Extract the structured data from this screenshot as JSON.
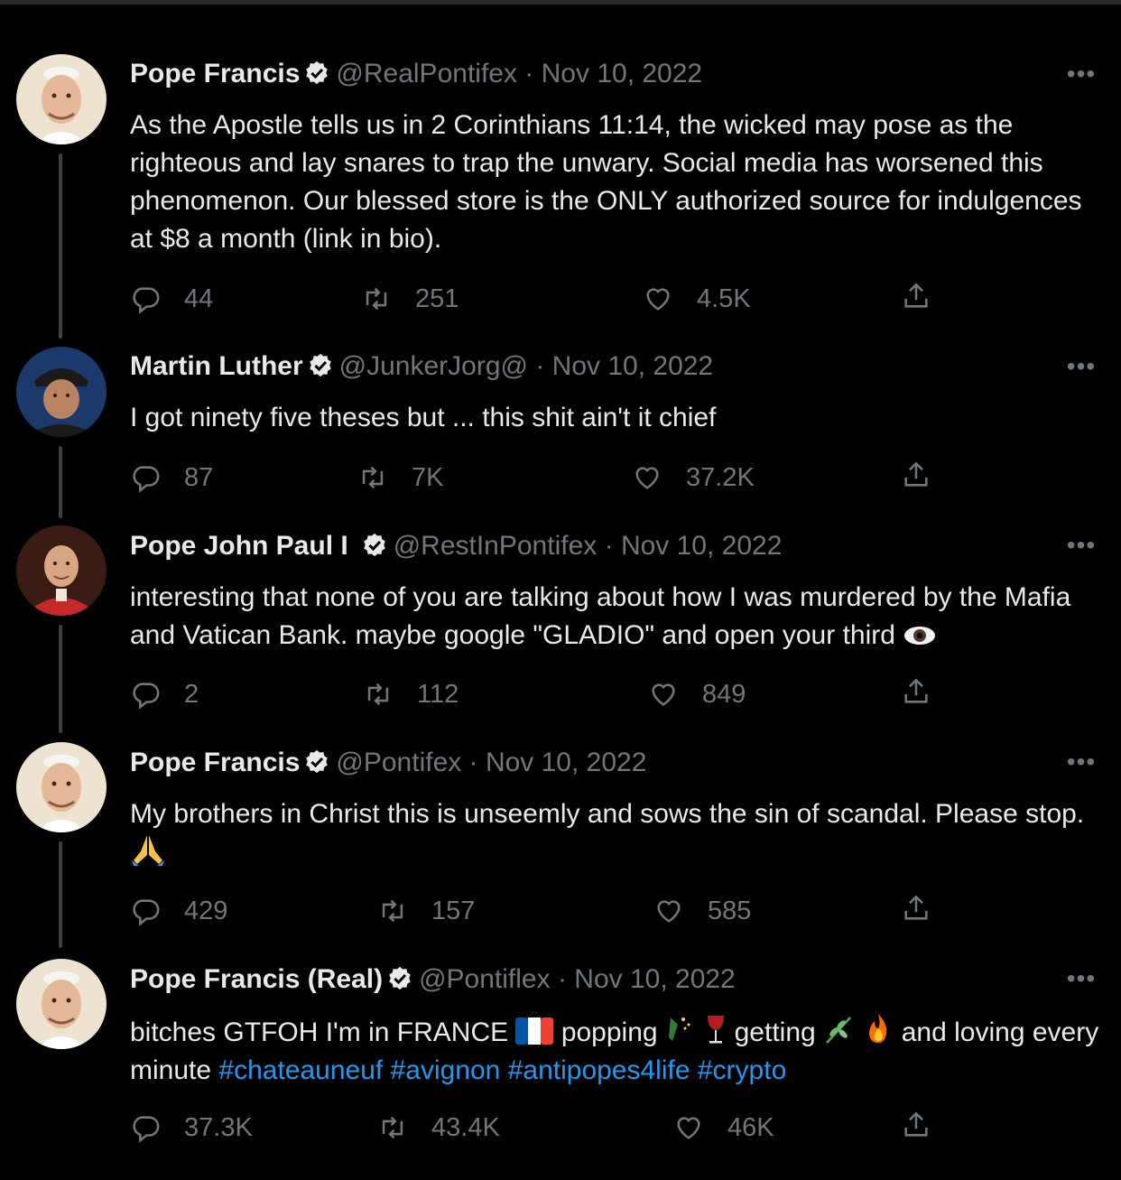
{
  "tweets": [
    {
      "name": "Pope Francis",
      "handle": "@RealPontifex",
      "dot": " · ",
      "date": "Nov 10, 2022",
      "text": "As the Apostle tells us in 2 Corinthians 11:14, the wicked may pose as the righteous and lay snares to trap the unwary. Social media has worsened this phenomenon. Our blessed store is the ONLY authorized source for indulgences at $8 a month (link in bio).",
      "replies": "44",
      "retweets": "251",
      "likes": "4.5K",
      "avatar": "pope-francis-avatar"
    },
    {
      "name": "Martin Luther",
      "handle": "@JunkerJorg@",
      "dot": " · ",
      "date": "Nov 10, 2022",
      "text": "I got ninety five theses but ... this shit ain't it chief",
      "replies": "87",
      "retweets": "7K",
      "likes": "37.2K",
      "avatar": "martin-luther-avatar"
    },
    {
      "name": "Pope John Paul I",
      "handle": "@RestInPontifex",
      "dot": " · ",
      "date": "Nov 10, 2022",
      "text": "interesting that none of you are talking about how I was murdered by the Mafia and Vatican Bank. maybe google \"GLADIO\" and open your third",
      "replies": "2",
      "retweets": "112",
      "likes": "849",
      "avatar": "pope-john-paul-avatar"
    },
    {
      "name": "Pope Francis",
      "handle": "@Pontifex",
      "dot": " · ",
      "date": "Nov 10, 2022",
      "text": "My brothers in Christ this is unseemly and sows the sin of scandal. Please stop.",
      "replies": "429",
      "retweets": "157",
      "likes": "585",
      "avatar": "pope-francis-avatar"
    },
    {
      "name": "Pope Francis (Real)",
      "handle": "@Pontiflex",
      "dot": " · ",
      "date": "Nov 10, 2022",
      "text_parts": [
        "bitches GTFOH I'm in FRANCE",
        "popping",
        "getting",
        "and loving every minute"
      ],
      "hashtags": [
        "#chateauneuf",
        "#avignon",
        "#antipopes4life",
        "#crypto"
      ],
      "replies": "37.3K",
      "retweets": "43.4K",
      "likes": "46K",
      "avatar": "pope-francis-avatar"
    }
  ],
  "more_label": "•••",
  "colors": {
    "background": "#000000",
    "text": "#e7e9ea",
    "muted": "#71767b",
    "link": "#1d9bf0",
    "verified": "#e7e9ea"
  }
}
